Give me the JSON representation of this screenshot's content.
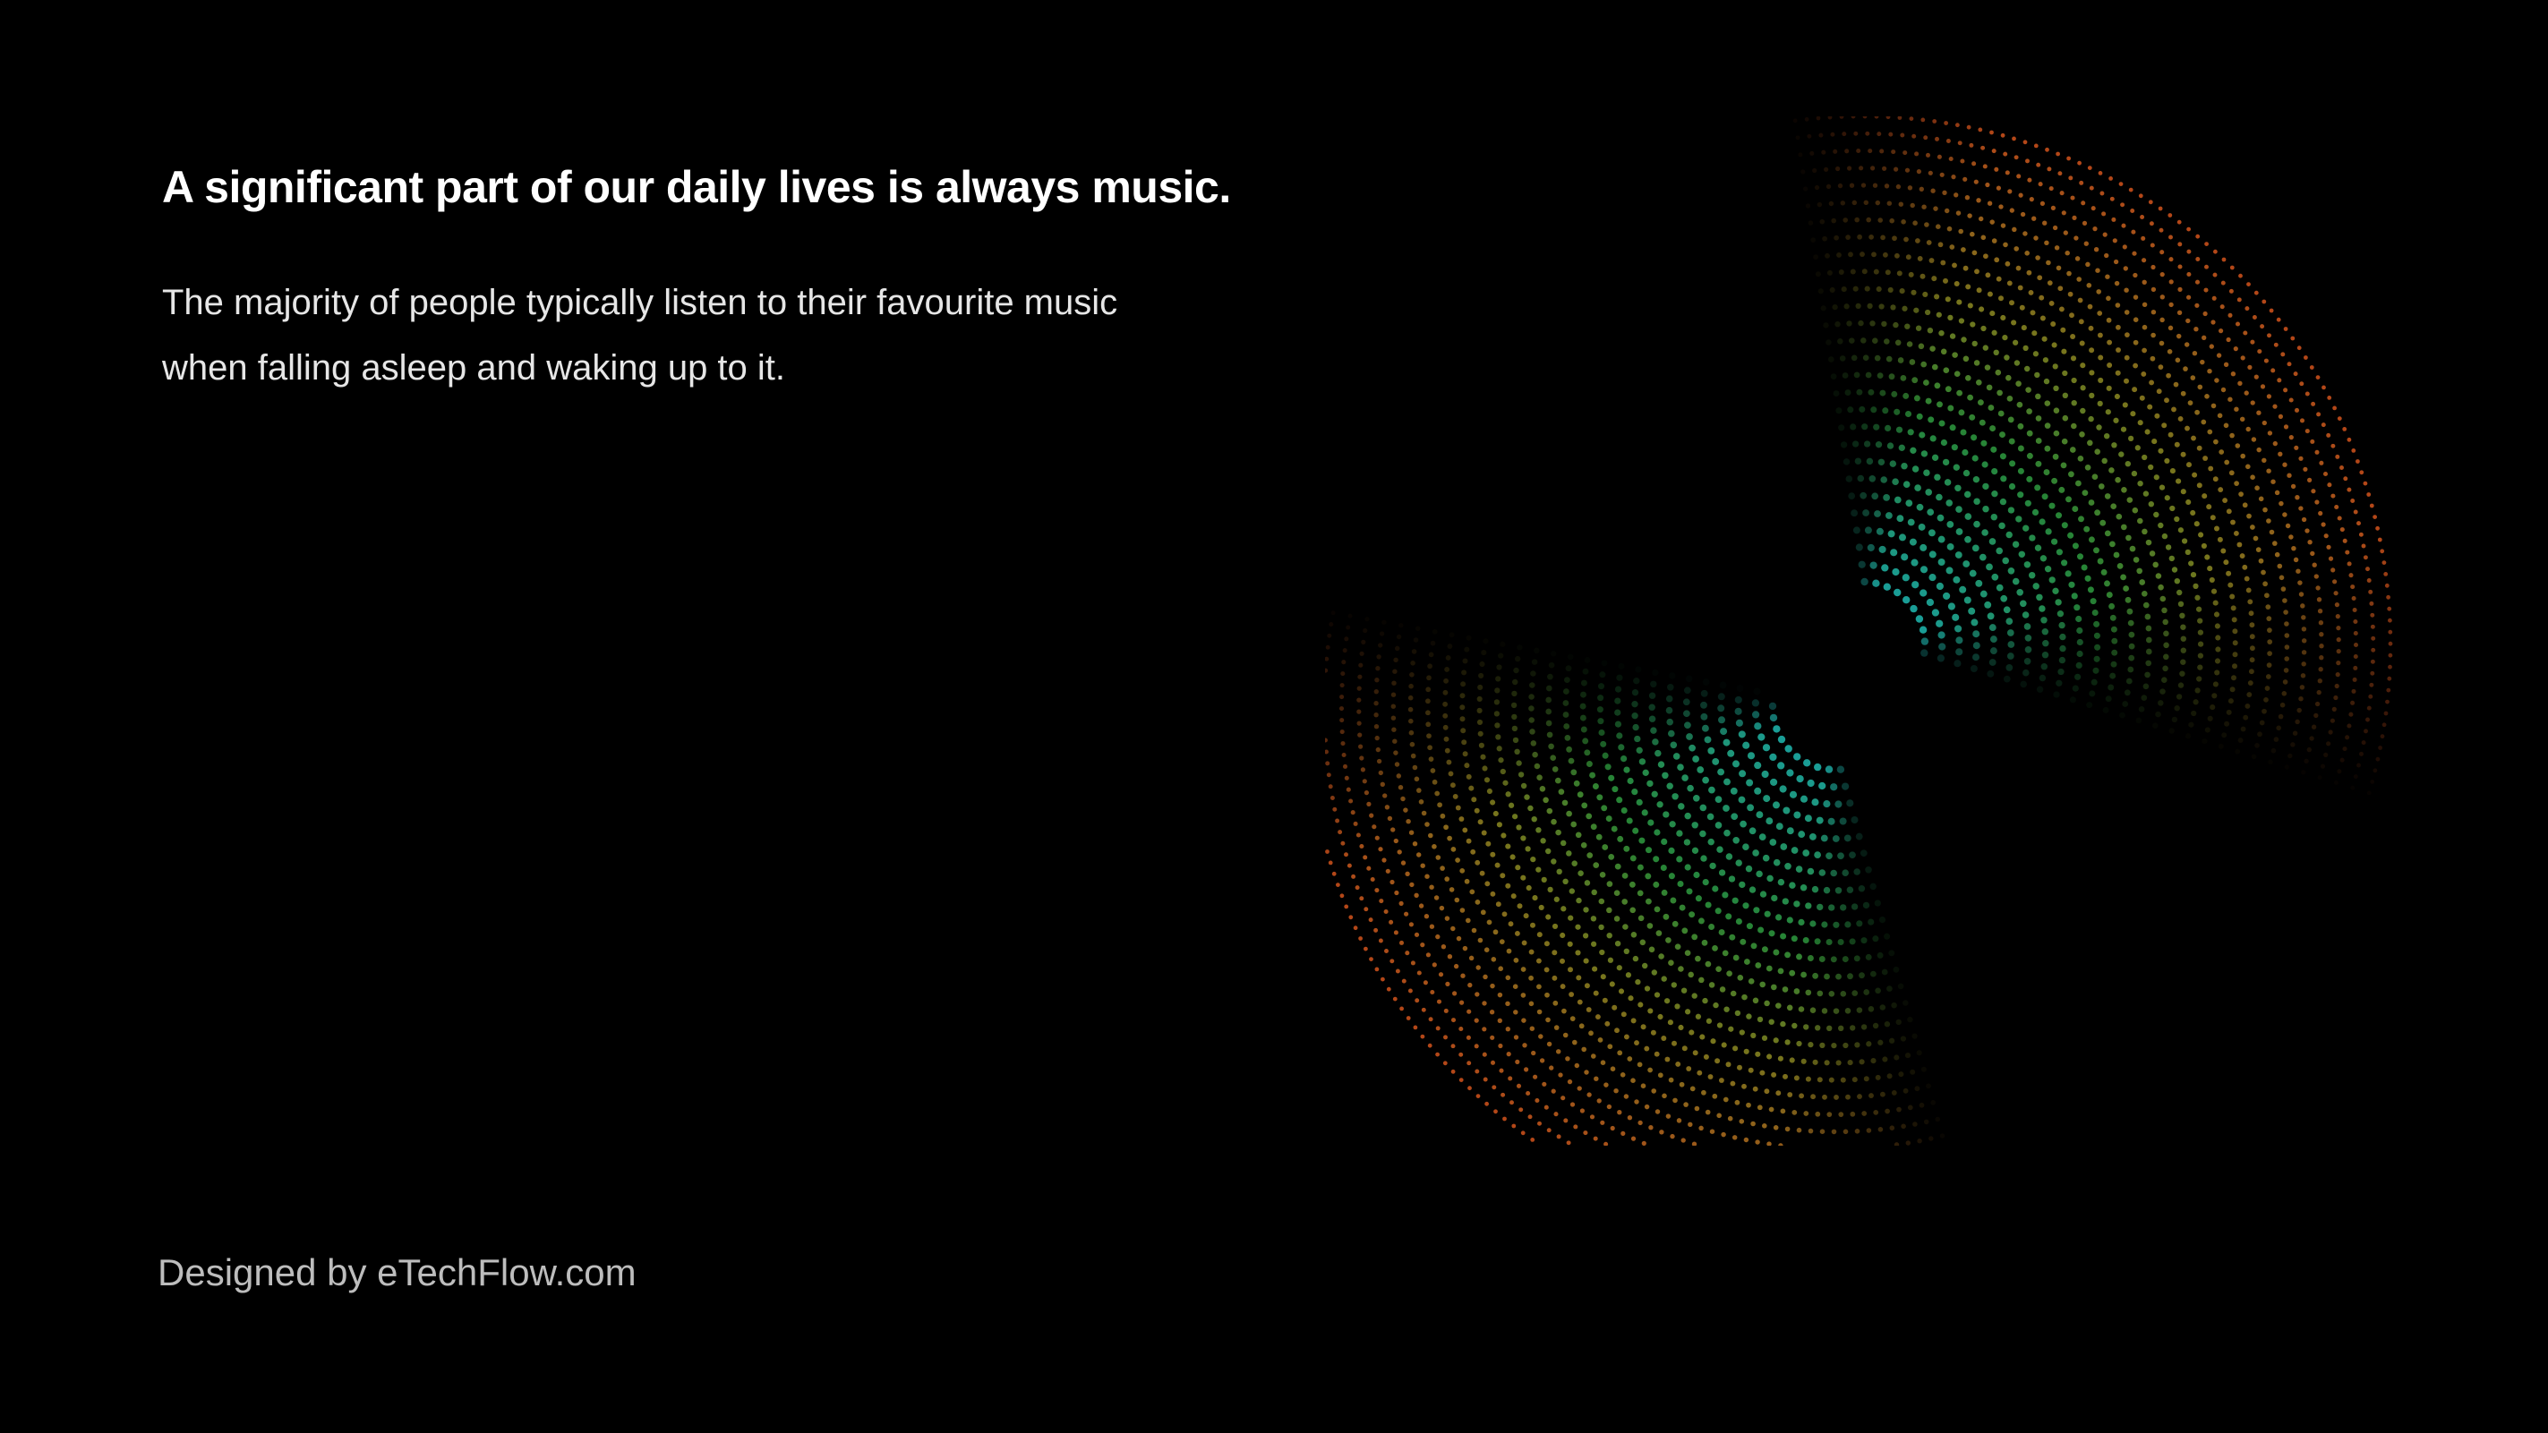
{
  "slide": {
    "headline": "A significant part of our daily lives is always music.",
    "body_lines": [
      "The majority of people typically listen to their favourite music",
      "when falling asleep and waking up to it."
    ],
    "credit": "Designed by eTechFlow.com"
  },
  "visual": {
    "name": "dotted-sound-wave-rings",
    "colors": {
      "inner": "#1fb8b0",
      "middle": "#2e9a3c",
      "transition": "#8a8a22",
      "outer": "#d2541c"
    }
  }
}
